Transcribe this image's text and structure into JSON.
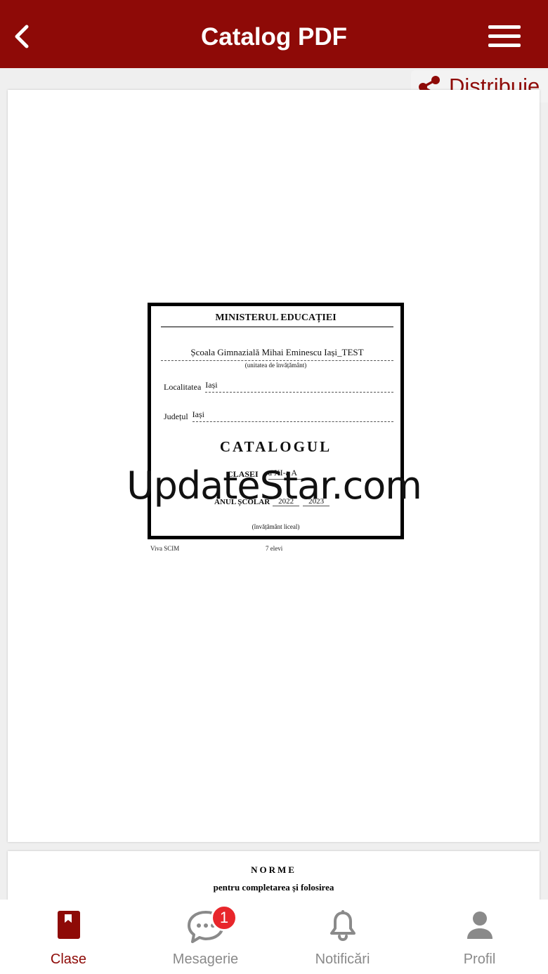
{
  "header": {
    "title": "Catalog PDF",
    "back_icon": "chevron-left-icon",
    "menu_icon": "hamburger-menu-icon"
  },
  "share": {
    "label": "Distribuie",
    "icon": "share-icon"
  },
  "document": {
    "ministry": "MINISTERUL EDUCAȚIEI",
    "school": "Școala Gimnazială Mihai Eminescu Iași_TEST",
    "unit_caption": "(unitatea de învățământ)",
    "locality_label": "Localitatea",
    "locality_value": "Iași",
    "county_label": "Județul",
    "county_value": "Iași",
    "catalog_title": "CATALOGUL",
    "class_label": "CLASEI",
    "class_value": "a XI-a A",
    "school_year_label": "ANUL ȘCOLAR",
    "year_start": "2022",
    "year_end": "2023",
    "education_level": "(învățământ liceal)",
    "footer_left": "Viva SCIM",
    "footer_right": "7 elevi"
  },
  "watermark": "UpdateStar.com",
  "page2": {
    "heading": "NORME",
    "subheading": "pentru completarea și folosirea"
  },
  "tabbar": {
    "tabs": [
      {
        "label": "Clase",
        "icon": "book-icon"
      },
      {
        "label": "Mesagerie",
        "icon": "chat-bubble-icon",
        "badge": "1"
      },
      {
        "label": "Notificări",
        "icon": "bell-icon"
      },
      {
        "label": "Profil",
        "icon": "user-icon"
      }
    ]
  },
  "colors": {
    "brand": "#8e0a07",
    "badge": "#e8262b",
    "inactive": "#8a8a8a"
  }
}
